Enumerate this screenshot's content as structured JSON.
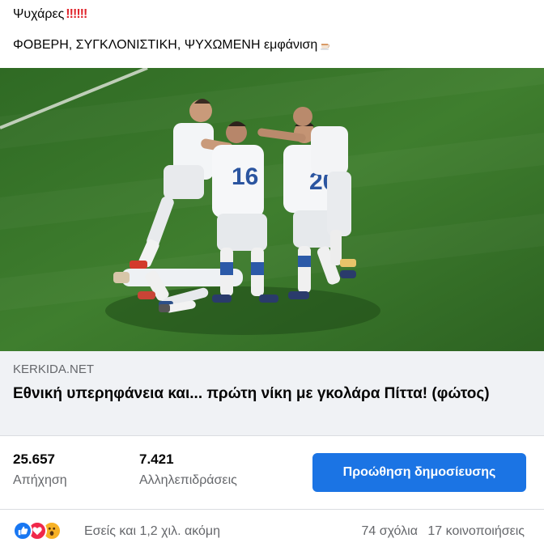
{
  "caption": {
    "line1_text": "Ψυχάρες",
    "line1_emojis": "‼‼‼",
    "line2_text": "ΦΟΒΕΡΗ, ΣΥΓΚΛΟΝΙΣΤΙΚΗ, ΨΥΧΩΜΕΝΗ εμφάνιση"
  },
  "photo": {
    "alt": "football-team-celebration",
    "jersey_numbers": [
      "16",
      "20"
    ]
  },
  "link": {
    "domain": "KERKIDA.NET",
    "title": "Εθνική υπερηφάνεια και... πρώτη νίκη με γκολάρα Πίττα! (φώτος)"
  },
  "stats": {
    "reach_value": "25.657",
    "reach_label": "Απήχηση",
    "engagement_value": "7.421",
    "engagement_label": "Αλληλεπιδράσεις",
    "boost_label": "Προώθηση δημοσίευσης"
  },
  "footer": {
    "reactions_text": "Εσείς και 1,2 χιλ. ακόμη",
    "comments": "74 σχόλια",
    "shares": "17 κοινοποιήσεις",
    "reaction_icons": [
      "like-icon",
      "love-icon",
      "wow-icon"
    ]
  },
  "colors": {
    "accent": "#1b74e4",
    "pitch": "#3f7a2c",
    "jersey": "#f4f6f8",
    "jersey_number": "#2b55a0"
  }
}
